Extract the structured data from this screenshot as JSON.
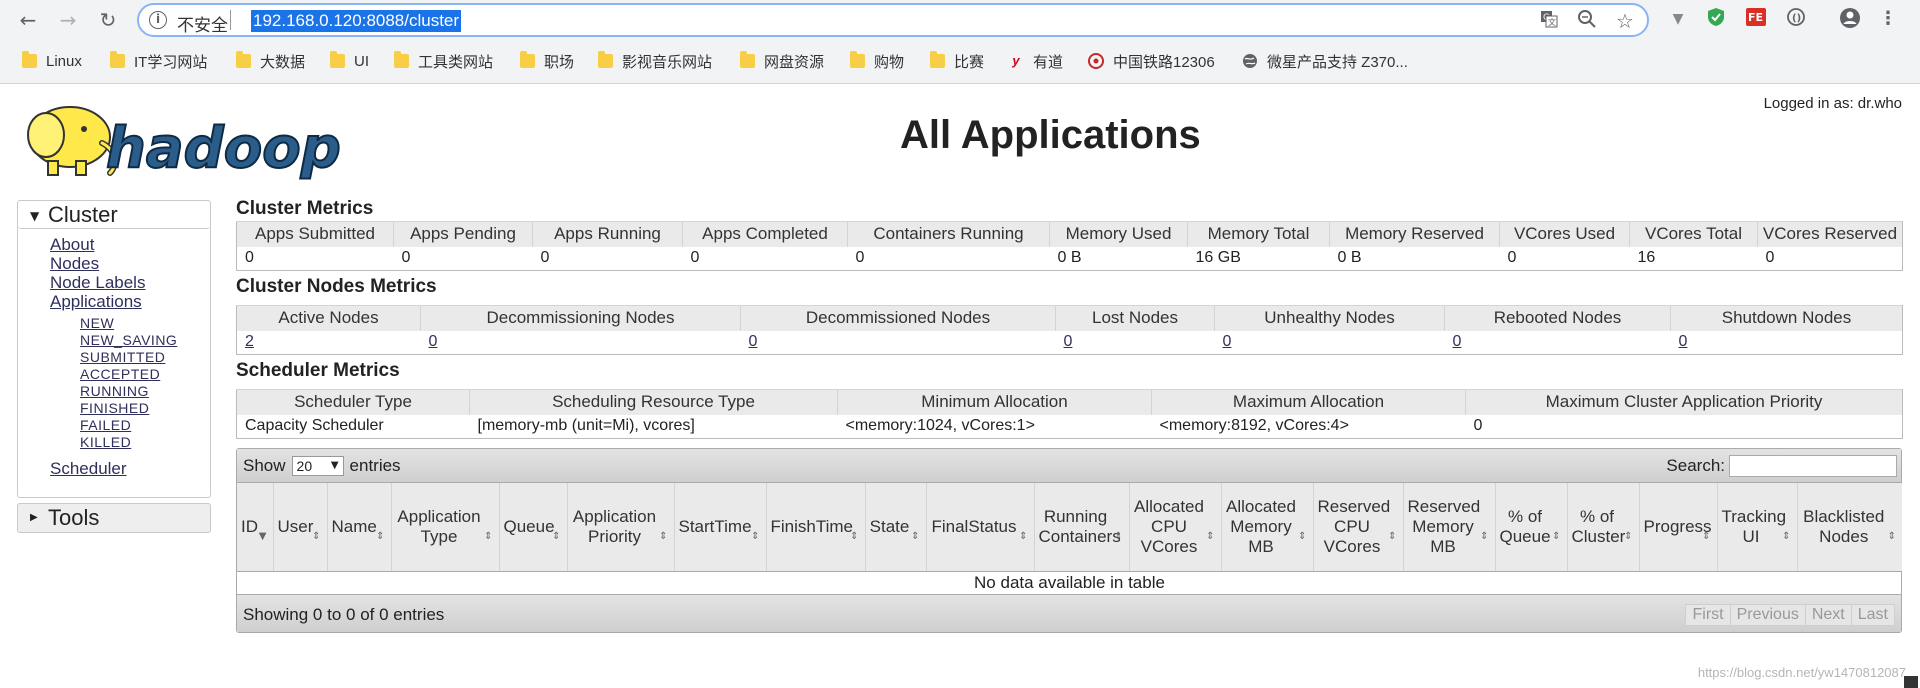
{
  "browser": {
    "nav": {
      "back": "←",
      "forward": "→",
      "reload": "↻"
    },
    "omnibox": {
      "insecure_label": "不安全",
      "url": "192.168.0.120:8088/cluster"
    },
    "bookmarks": [
      {
        "label": "Linux",
        "icon": "folder-icon"
      },
      {
        "label": "IT学习网站",
        "icon": "folder-icon"
      },
      {
        "label": "大数据",
        "icon": "folder-icon"
      },
      {
        "label": "UI",
        "icon": "folder-icon"
      },
      {
        "label": "工具类网站",
        "icon": "folder-icon"
      },
      {
        "label": "职场",
        "icon": "folder-icon"
      },
      {
        "label": "影视音乐网站",
        "icon": "folder-icon"
      },
      {
        "label": "网盘资源",
        "icon": "folder-icon"
      },
      {
        "label": "购物",
        "icon": "folder-icon"
      },
      {
        "label": "比赛",
        "icon": "folder-icon"
      },
      {
        "label": "有道",
        "icon": "youdao-icon"
      },
      {
        "label": "中国铁路12306",
        "icon": "railway-icon"
      },
      {
        "label": "微星产品支持 Z370...",
        "icon": "globe-icon"
      }
    ]
  },
  "header": {
    "logged_in": "Logged in as: dr.who",
    "title": "All Applications",
    "logo_text": "hadoop"
  },
  "nav": {
    "cluster_label": "Cluster",
    "links": [
      "About",
      "Nodes",
      "Node Labels",
      "Applications"
    ],
    "app_states": [
      "NEW",
      "NEW_SAVING",
      "SUBMITTED",
      "ACCEPTED",
      "RUNNING",
      "FINISHED",
      "FAILED",
      "KILLED"
    ],
    "scheduler": "Scheduler",
    "tools_label": "Tools"
  },
  "cluster_metrics": {
    "title": "Cluster Metrics",
    "headers": [
      "Apps Submitted",
      "Apps Pending",
      "Apps Running",
      "Apps Completed",
      "Containers Running",
      "Memory Used",
      "Memory Total",
      "Memory Reserved",
      "VCores Used",
      "VCores Total",
      "VCores Reserved"
    ],
    "values": [
      "0",
      "0",
      "0",
      "0",
      "0",
      "0 B",
      "16 GB",
      "0 B",
      "0",
      "16",
      "0"
    ]
  },
  "node_metrics": {
    "title": "Cluster Nodes Metrics",
    "headers": [
      "Active Nodes",
      "Decommissioning Nodes",
      "Decommissioned Nodes",
      "Lost Nodes",
      "Unhealthy Nodes",
      "Rebooted Nodes",
      "Shutdown Nodes"
    ],
    "values": [
      "2",
      "0",
      "0",
      "0",
      "0",
      "0",
      "0"
    ]
  },
  "scheduler_metrics": {
    "title": "Scheduler Metrics",
    "headers": [
      "Scheduler Type",
      "Scheduling Resource Type",
      "Minimum Allocation",
      "Maximum Allocation",
      "Maximum Cluster Application Priority"
    ],
    "values": [
      "Capacity Scheduler",
      "[memory-mb (unit=Mi), vcores]",
      "<memory:1024, vCores:1>",
      "<memory:8192, vCores:4>",
      "0"
    ]
  },
  "apps_table": {
    "show_label": "Show",
    "entries_label": "entries",
    "page_size": "20",
    "search_label": "Search:",
    "columns": [
      "ID",
      "User",
      "Name",
      "Application Type",
      "Queue",
      "Application Priority",
      "StartTime",
      "FinishTime",
      "State",
      "FinalStatus",
      "Running Containers",
      "Allocated CPU VCores",
      "Allocated Memory MB",
      "Reserved CPU VCores",
      "Reserved Memory MB",
      "% of Queue",
      "% of Cluster",
      "Progress",
      "Tracking UI",
      "Blacklisted Nodes"
    ],
    "empty_message": "No data available in table",
    "info": "Showing 0 to 0 of 0 entries",
    "pager": [
      "First",
      "Previous",
      "Next",
      "Last"
    ]
  },
  "watermark": "https://blog.csdn.net/yw1470812087"
}
